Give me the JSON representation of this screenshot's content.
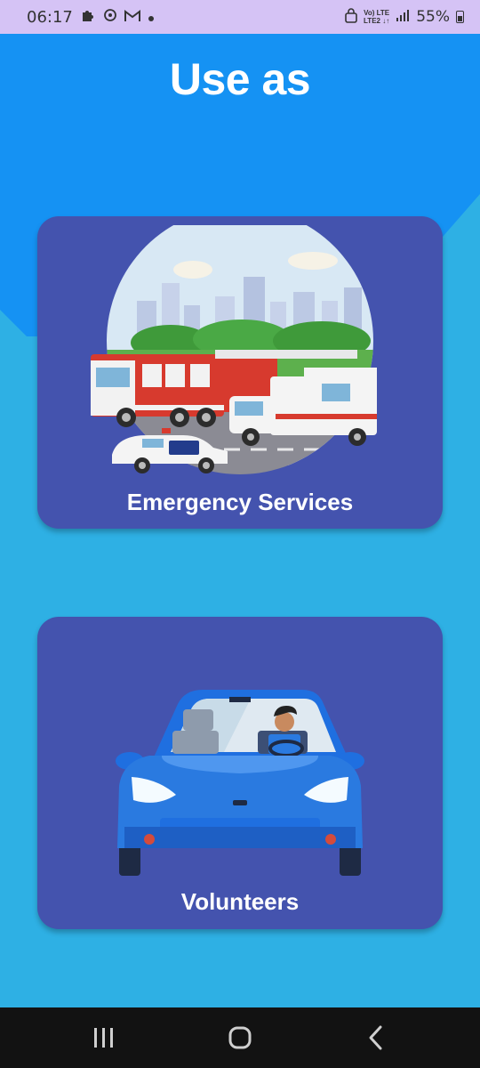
{
  "status_bar": {
    "time": "06:17",
    "network_top": "Vo) LTE",
    "network_bottom": "LTE2 ↓↑",
    "battery": "55%",
    "icons": [
      "puzzle-icon",
      "sync-icon",
      "gmail-icon",
      "dot-icon",
      "lock-icon",
      "signal-icon",
      "battery-icon"
    ]
  },
  "page": {
    "title": "Use as"
  },
  "options": [
    {
      "label": "Emergency Services",
      "icon": "emergency-vehicles-illustration"
    },
    {
      "label": "Volunteers",
      "icon": "car-driver-illustration"
    }
  ],
  "nav": {
    "icons": [
      "recents-icon",
      "home-icon",
      "back-icon"
    ]
  },
  "colors": {
    "status_bar": "#d5c3f5",
    "header_blue": "#1592f3",
    "background": "#2eb0e4",
    "card": "#4453ae",
    "nav_bar": "#121212"
  }
}
